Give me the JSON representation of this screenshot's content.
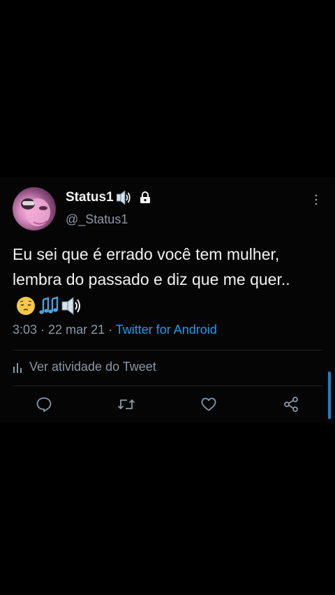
{
  "tweet": {
    "display_name": "Status1",
    "handle": "@_Status1",
    "text": "Eu sei que é errado você tem mulher, lembra do passado  e diz que me quer..",
    "name_icons": [
      "speaker-icon",
      "lock-icon"
    ],
    "text_emojis": [
      "pensive-face-icon",
      "music-notes-icon",
      "speaker-icon"
    ],
    "time": "3:03",
    "date": "22 mar 21",
    "separator": " · ",
    "source": "Twitter for Android"
  },
  "activity": {
    "label": "Ver atividade do Tweet",
    "icon": "bar-chart-icon"
  },
  "actions": {
    "reply": "reply-icon",
    "retweet": "retweet-icon",
    "like": "like-icon",
    "share": "share-icon"
  },
  "colors": {
    "background": "#000000",
    "card": "#050505",
    "text": "#f2f2f2",
    "secondary": "#8b98a5",
    "accent": "#1d9bf0"
  }
}
